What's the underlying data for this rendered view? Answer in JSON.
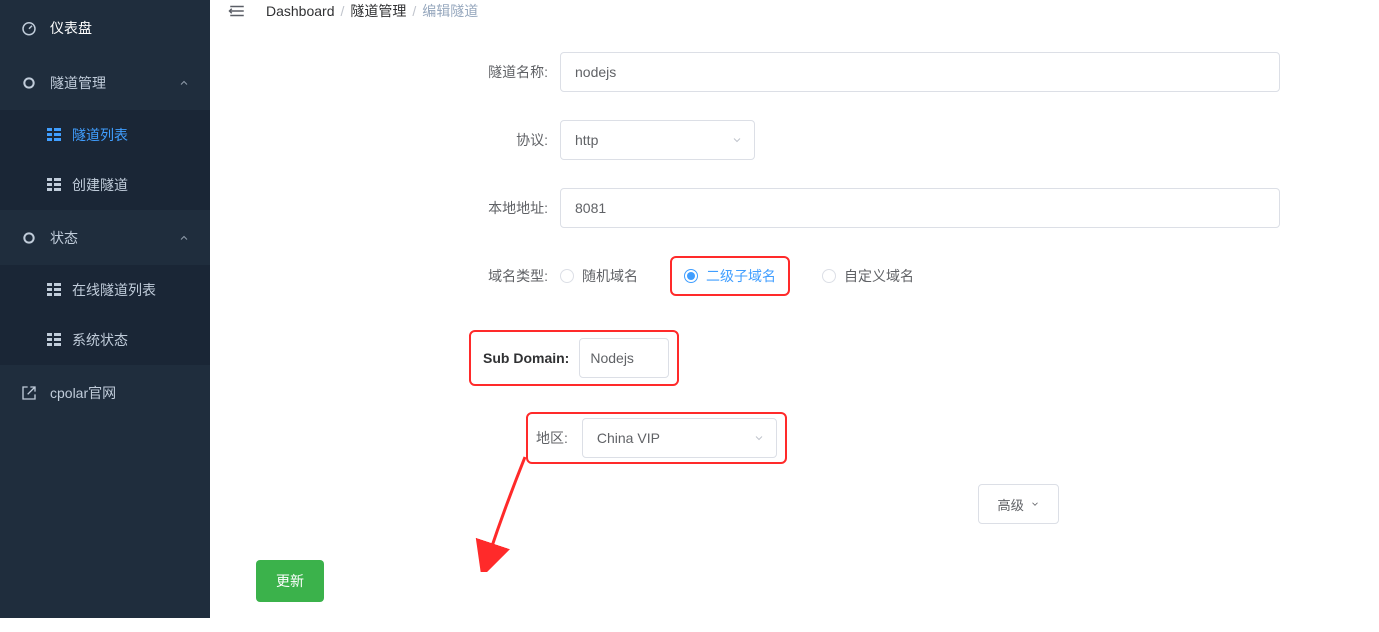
{
  "sidebar": {
    "items": [
      {
        "label": "仪表盘"
      },
      {
        "label": "隧道管理"
      },
      {
        "label": "状态"
      }
    ],
    "tunnel_subitems": [
      {
        "label": "隧道列表"
      },
      {
        "label": "创建隧道"
      }
    ],
    "status_subitems": [
      {
        "label": "在线隧道列表"
      },
      {
        "label": "系统状态"
      }
    ],
    "external": {
      "label": "cpolar官网"
    }
  },
  "breadcrumb": {
    "a": "Dashboard",
    "b": "隧道管理",
    "c": "编辑隧道"
  },
  "form": {
    "tunnel_name_label": "隧道名称:",
    "tunnel_name_value": "nodejs",
    "protocol_label": "协议:",
    "protocol_value": "http",
    "local_addr_label": "本地地址:",
    "local_addr_value": "8081",
    "domain_type_label": "域名类型:",
    "domain_type_options": {
      "random": "随机域名",
      "sub": "二级子域名",
      "custom": "自定义域名"
    },
    "subdomain_label": "Sub Domain:",
    "subdomain_value": "Nodejs",
    "region_label": "地区:",
    "region_value": "China VIP",
    "advanced_label": "高级",
    "update_label": "更新"
  }
}
